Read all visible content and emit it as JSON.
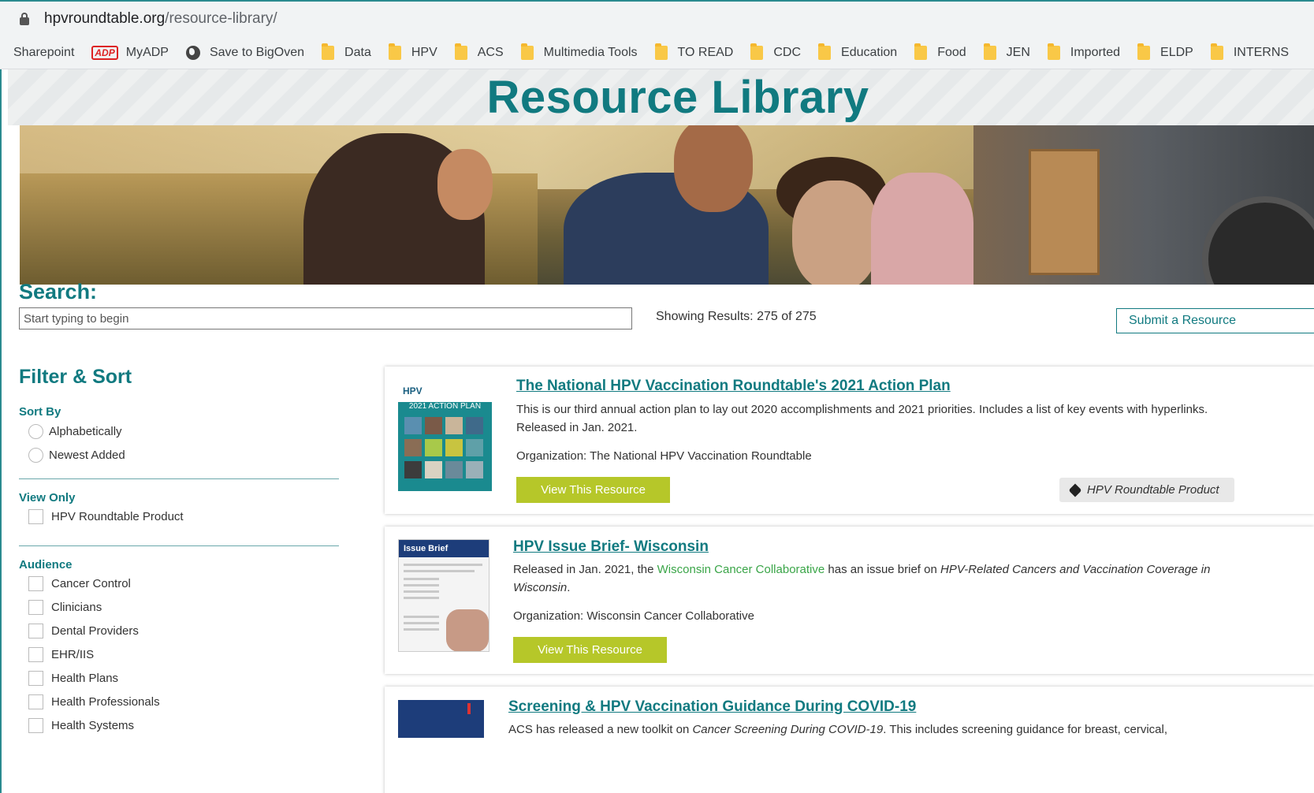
{
  "browser": {
    "url_domain": "hpvroundtable.org",
    "url_path": "/resource-library/",
    "bookmarks": [
      "Sharepoint",
      "MyADP",
      "Save to BigOven",
      "Data",
      "HPV",
      "ACS",
      "Multimedia Tools",
      "TO READ",
      "CDC",
      "Education",
      "Food",
      "JEN",
      "Imported",
      "ELDP",
      "INTERNS"
    ],
    "adp_logo_text": "ADP"
  },
  "page": {
    "title": "Resource Library",
    "search_label": "Search:",
    "search_placeholder": "Start typing to begin",
    "results_text": "Showing Results: 275 of 275",
    "submit_label": "Submit a Resource"
  },
  "sidebar": {
    "title": "Filter & Sort",
    "sort_by": {
      "label": "Sort By",
      "options": [
        "Alphabetically",
        "Newest Added"
      ]
    },
    "view_only": {
      "label": "View Only",
      "options": [
        "HPV Roundtable Product"
      ]
    },
    "audience": {
      "label": "Audience",
      "options": [
        "Cancer Control",
        "Clinicians",
        "Dental Providers",
        "EHR/IIS",
        "Health Plans",
        "Health Professionals",
        "Health Systems"
      ]
    }
  },
  "cards": [
    {
      "title": "The National HPV Vaccination Roundtable's 2021 Action Plan",
      "desc": "This is our third annual action plan to lay out 2020 accomplishments and 2021 priorities.  Includes a list of key events with hyperlinks.  Released in Jan. 2021.",
      "org": "Organization: The National HPV Vaccination Roundtable",
      "button": "View This Resource",
      "tag": "HPV Roundtable Product",
      "thumb_logo": "HPV",
      "thumb_banner": "2021 ACTION PLAN"
    },
    {
      "title": "HPV Issue Brief- Wisconsin",
      "desc_1": "Released in Jan. 2021, the ",
      "desc_link": "Wisconsin Cancer Collaborative",
      "desc_2": " has an issue brief on ",
      "desc_italic": "HPV-Related Cancers and Vaccination Coverage in Wisconsin",
      "desc_3": ".",
      "org": "Organization: Wisconsin Cancer Collaborative",
      "button": "View This Resource",
      "thumb_header": "Issue Brief"
    },
    {
      "title": "Screening & HPV Vaccination Guidance During COVID-19",
      "desc_1": "ACS has released a new toolkit on ",
      "desc_italic": "Cancer Screening During COVID-19",
      "desc_2": ". This includes screening guidance for breast, cervical,"
    }
  ],
  "colors": {
    "brand_teal": "#117a80",
    "button_green": "#b6c729",
    "link_green": "#3aa548"
  }
}
